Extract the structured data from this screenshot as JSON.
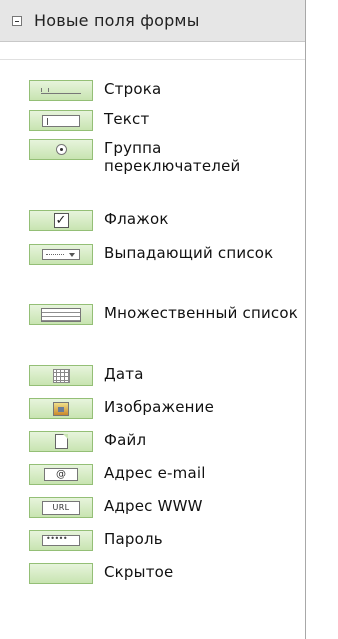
{
  "panel": {
    "title": "Новые поля формы",
    "colors": {
      "header": "#e6e6e6",
      "button_border": "#94bf76",
      "button_fill": "#c8e4b1",
      "border": "#a8a8a8"
    }
  },
  "fields": [
    {
      "label": "Строка",
      "icon": "single-line-input-icon"
    },
    {
      "label": "Текст",
      "icon": "text-area-icon"
    },
    {
      "label": "Группа переключателей",
      "icon": "radio-group-icon"
    },
    {
      "label": "Флажок",
      "icon": "checkbox-icon",
      "glyph": "✓"
    },
    {
      "label": "Выпадающий список",
      "icon": "dropdown-list-icon"
    },
    {
      "label": "Множественный список",
      "icon": "multi-select-list-icon"
    },
    {
      "label": "Дата",
      "icon": "calendar-icon"
    },
    {
      "label": "Изображение",
      "icon": "image-icon"
    },
    {
      "label": "Файл",
      "icon": "file-icon"
    },
    {
      "label": "Адрес e-mail",
      "icon": "email-icon",
      "glyph": "@"
    },
    {
      "label": "Адрес WWW",
      "icon": "url-icon",
      "glyph": "URL"
    },
    {
      "label": "Пароль",
      "icon": "password-icon",
      "glyph": "•••••"
    },
    {
      "label": "Скрытое",
      "icon": "hidden-field-icon"
    }
  ]
}
